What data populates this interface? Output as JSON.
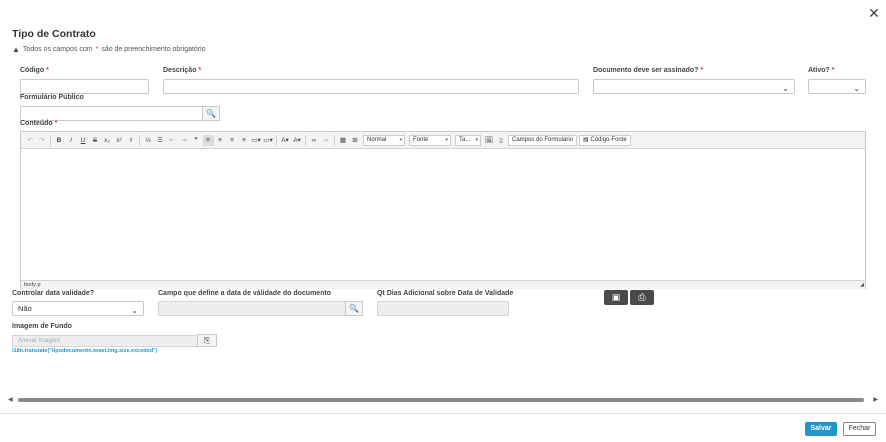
{
  "dialog": {
    "title": "Tipo de Contrato",
    "required_note_before": "Todos os campos com",
    "required_mark": "*",
    "required_note_after": "são de preenchimento obrigatório"
  },
  "fields": {
    "codigo": {
      "label": "Código",
      "required": "*"
    },
    "descricao": {
      "label": "Descrição",
      "required": "*"
    },
    "documento_assinado": {
      "label": "Documento deve ser assinado?",
      "required": "*",
      "value": ""
    },
    "ativo": {
      "label": "Ativo?",
      "required": "*",
      "value": ""
    },
    "formulario_publico": {
      "label": "Formulário Público"
    },
    "conteudo": {
      "label": "Conteúdo",
      "required": "*"
    },
    "controlar_validade": {
      "label": "Controlar data validade?",
      "value": "Não"
    },
    "campo_validade": {
      "label": "Campo que define a data de válidade do documento"
    },
    "qt_dias": {
      "label": "Qt Dias Adicional sobre Data de Validade"
    },
    "imagem_fundo": {
      "label": "Imagem de Fundo",
      "placeholder": "Anexar imagem"
    }
  },
  "editor": {
    "format_combo": "Normal",
    "font_combo": "Fonte",
    "size_combo": "Ta...",
    "campos_button": "Campos do Formulário",
    "source_button": "Código-Fonte",
    "path_body": "body",
    "path_p": "p"
  },
  "toast_message": "i18n.translate(\"tipodocumento.toast.img.size.exceded\")",
  "footer": {
    "save_label": "Salvar",
    "close_label": "Fechar"
  },
  "colors": {
    "accent": "#2196c9",
    "required": "#e53935",
    "dark_button": "#4a4a4a"
  }
}
